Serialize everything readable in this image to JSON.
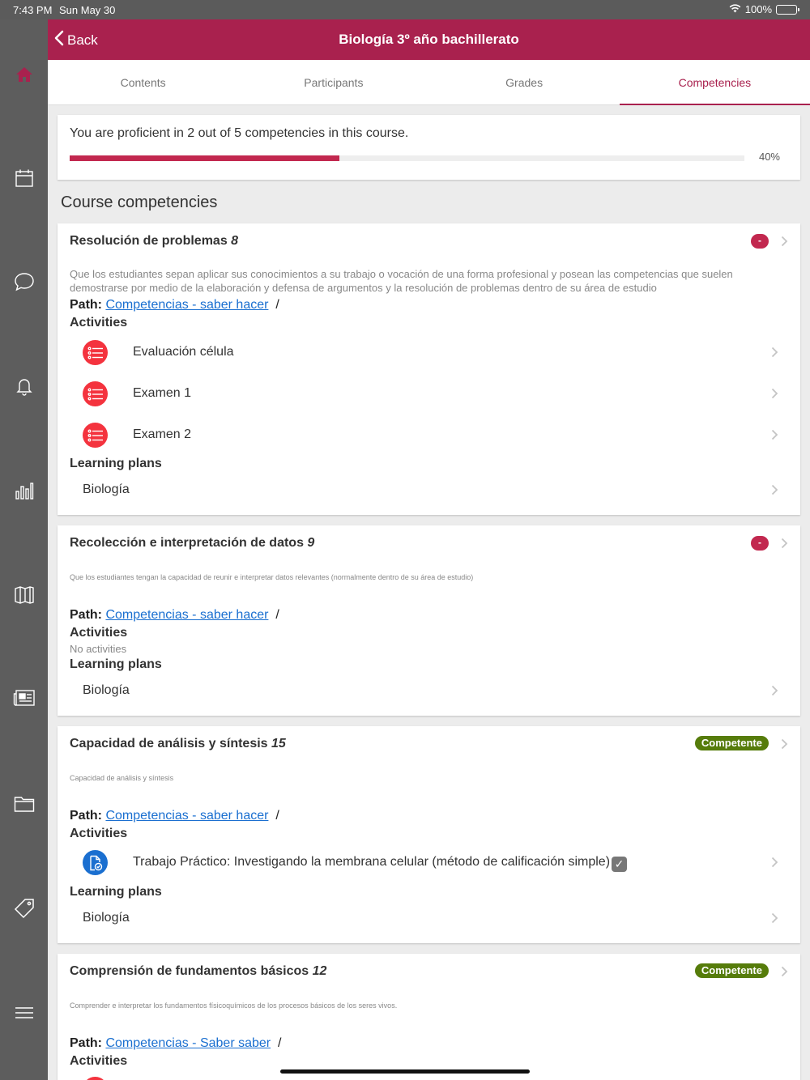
{
  "status_bar": {
    "time": "7:43 PM",
    "date": "Sun May 30",
    "battery": "100%"
  },
  "sidebar": {
    "items": [
      {
        "name": "home-icon"
      },
      {
        "name": "calendar-icon"
      },
      {
        "name": "messages-icon"
      },
      {
        "name": "notifications-icon"
      },
      {
        "name": "grades-chart-icon"
      },
      {
        "name": "map-icon"
      },
      {
        "name": "news-icon"
      },
      {
        "name": "files-folder-icon"
      },
      {
        "name": "tag-icon"
      },
      {
        "name": "menu-icon"
      }
    ],
    "active_color": "#a9214e"
  },
  "header": {
    "back_label": "Back",
    "title": "Biología 3º año bachillerato",
    "color": "#a9214e"
  },
  "tabs": [
    {
      "label": "Contents"
    },
    {
      "label": "Participants"
    },
    {
      "label": "Grades"
    },
    {
      "label": "Competencies",
      "active": true
    }
  ],
  "summary": {
    "text": "You are proficient in 2 out of 5 competencies in this course.",
    "progress": 0.4,
    "progress_label": "40%"
  },
  "section_title": "Course competencies",
  "labels": {
    "path": "Path:",
    "activities": "Activities",
    "learning_plans": "Learning plans",
    "separator": "/"
  },
  "competencies": [
    {
      "name": "Resolución de problemas",
      "number": "8",
      "badge": "-",
      "description": "Que los estudiantes sepan aplicar sus conocimientos a su trabajo o vocación de una forma profesional y posean las competencias que suelen demostrarse por medio de la elaboración y defensa de argumentos y la resolución de problemas dentro de su área de estudio",
      "path_link": "Competencias - saber hacer",
      "activities": [
        {
          "name": "Evaluación célula",
          "icon": "quiz-list-icon"
        },
        {
          "name": "Examen 1",
          "icon": "quiz-list-icon"
        },
        {
          "name": "Examen 2",
          "icon": "quiz-list-icon"
        }
      ],
      "learning_plans": [
        "Biología"
      ]
    },
    {
      "name": "Recolección e interpretación de datos",
      "number": "9",
      "badge": "-",
      "description": "Que los estudiantes tengan la capacidad de reunir e interpretar datos relevantes (normalmente dentro de su área de estudio)",
      "path_link": "Competencias - saber hacer",
      "no_activities": "No activities",
      "learning_plans": [
        "Biología"
      ]
    },
    {
      "name": "Capacidad de análisis y síntesis",
      "number": "15",
      "badge": "Competente",
      "description": "Capacidad de análisis y síntesis",
      "path_link": "Competencias - saber hacer",
      "activities": [
        {
          "name": "Trabajo Práctico: Investigando la membrana celular (método de calificación simple)",
          "icon": "assignment-icon",
          "completed": true
        }
      ],
      "learning_plans": [
        "Biología"
      ]
    },
    {
      "name": "Comprensión de fundamentos básicos",
      "number": "12",
      "badge": "Competente",
      "description": "Comprender e interpretar los fundamentos físicoquímicos de los procesos básicos de los seres vivos.",
      "path_link": "Competencias - Saber saber"
    }
  ]
}
